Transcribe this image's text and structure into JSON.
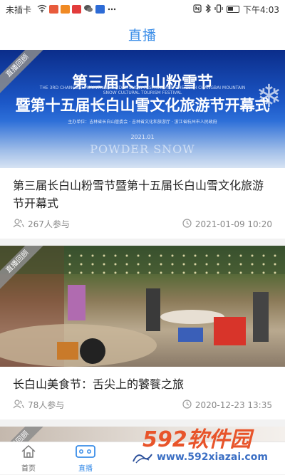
{
  "status_bar": {
    "carrier": "未插卡",
    "time": "下午4:03",
    "icons": [
      "wifi-icon",
      "app-icon",
      "app-icon",
      "app-icon",
      "wechat-icon",
      "app-icon",
      "more-icon"
    ]
  },
  "header": {
    "title": "直播"
  },
  "cards": [
    {
      "badge": "直播回顾",
      "poster": {
        "title_line1": "第三届长白山粉雪节",
        "title_line2": "暨第十五届长白山雪文化旅游节开幕式",
        "subtitle": "THE 3RD CHANGBAI MOUNTAIN POWDER SNOW FESTIVAL AND THE 15TH CHANGBAI MOUNTAIN SNOW CULTURAL TOURISM FESTIVAL",
        "organizers": "主办单位：吉林省长白山管委会 · 吉林省文化和旅游厅 · 浙江省杭州市人民政府",
        "date": "2021.01",
        "watermark_text": "POWDER SNOW"
      },
      "title": "第三届长白山粉雪节暨第十五届长白山雪文化旅游节开幕式",
      "participants": "267人参与",
      "datetime": "2021-01-09 10:20"
    },
    {
      "badge": "直播回顾",
      "title": "长白山美食节：舌尖上的饕餮之旅",
      "participants": "78人参与",
      "datetime": "2020-12-23 13:35"
    },
    {
      "badge": "直播回顾"
    }
  ],
  "tabbar": {
    "tabs": [
      {
        "label": "首页",
        "icon": "home-icon"
      },
      {
        "label": "直播",
        "icon": "video-camera-icon",
        "active": true
      },
      {
        "label": "",
        "icon": "logo-icon"
      }
    ]
  },
  "watermark": {
    "brand": "592软件园",
    "url": "www.592xiazai.com"
  },
  "colors": {
    "accent": "#3a8de8",
    "ribbon": "#8c8c8c",
    "watermark": "#e8542a"
  }
}
